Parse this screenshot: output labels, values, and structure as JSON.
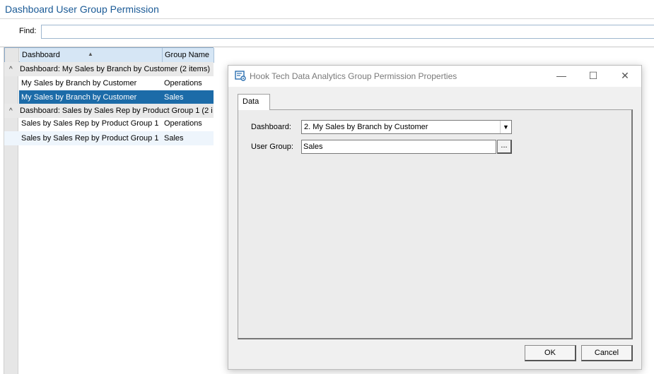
{
  "page": {
    "title": "Dashboard User Group Permission",
    "find_label": "Find:",
    "find_value": ""
  },
  "grid": {
    "columns": [
      "Dashboard",
      "Group Name"
    ],
    "groups": [
      {
        "header": "Dashboard: My Sales by Branch by Customer (2 items)",
        "rows": [
          {
            "dashboard": "My Sales by Branch by Customer",
            "group": "Operations"
          },
          {
            "dashboard": "My Sales by Branch by Customer",
            "group": "Sales"
          }
        ]
      },
      {
        "header": "Dashboard: Sales by Sales Rep by Product Group 1 (2 i",
        "rows": [
          {
            "dashboard": "Sales by Sales Rep by Product Group 1",
            "group": "Operations"
          },
          {
            "dashboard": "Sales by Sales Rep by Product Group 1",
            "group": "Sales"
          }
        ]
      }
    ]
  },
  "dialog": {
    "title": "Hook Tech Data Analytics Group Permission Properties",
    "tab": "Data",
    "dashboard_label": "Dashboard:",
    "dashboard_value": "2. My Sales by Branch by Customer",
    "usergroup_label": "User Group:",
    "usergroup_value": "Sales",
    "ellipsis": "...",
    "ok": "OK",
    "cancel": "Cancel",
    "minimize_glyph": "—",
    "maximize_glyph": "☐",
    "close_glyph": "✕"
  },
  "icons": {
    "sort": "▲",
    "collapse": "^",
    "dropdown": "▼"
  },
  "colors": {
    "title_blue": "#1a5a96",
    "selection": "#1c6ba8"
  }
}
